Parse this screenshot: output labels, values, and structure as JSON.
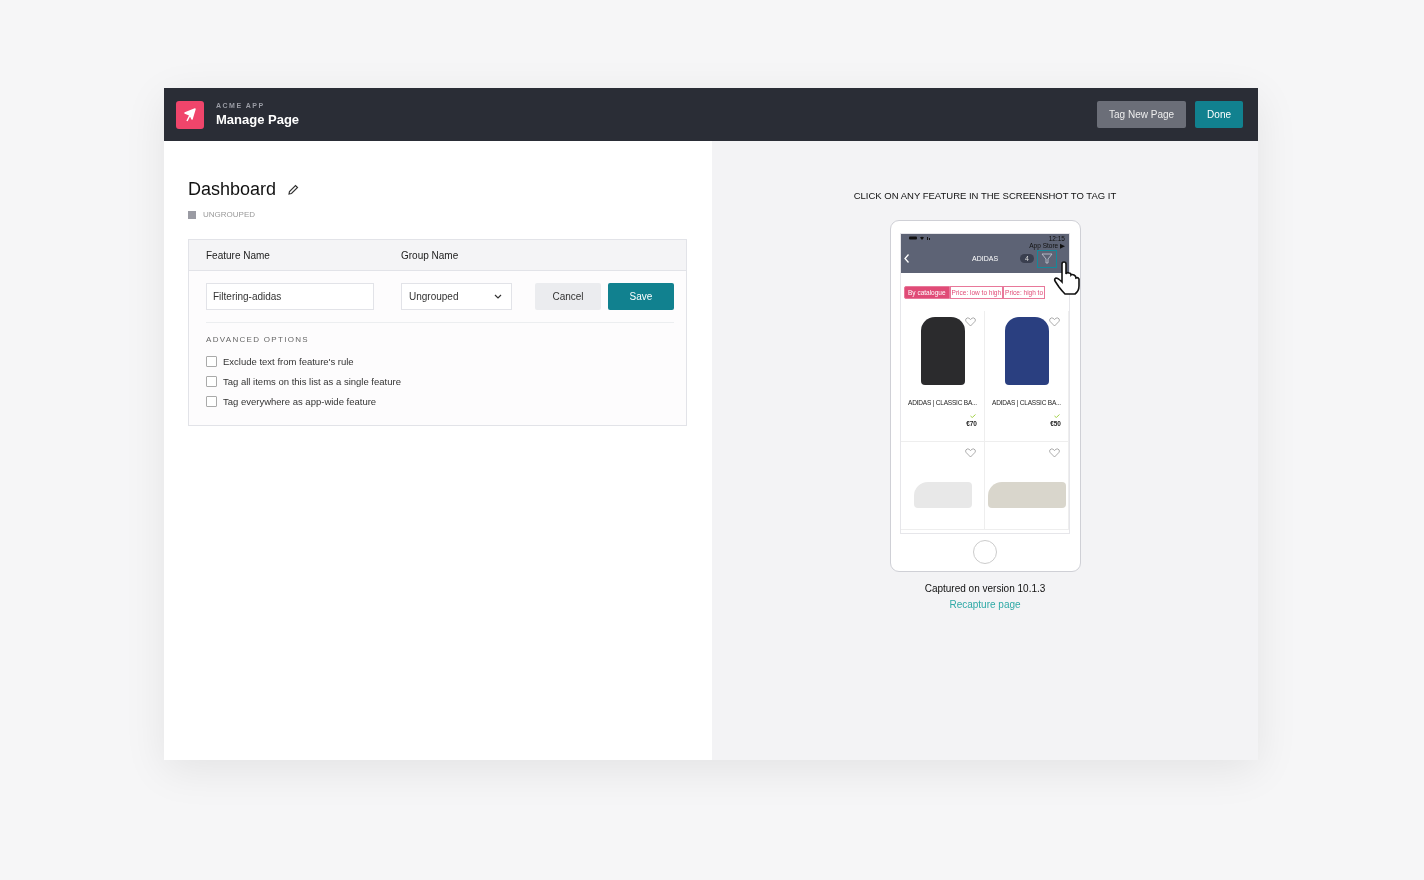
{
  "header": {
    "app_name": "ACME APP",
    "title": "Manage Page",
    "buttons": [
      {
        "label": "Tag New Page",
        "kind": "secondary"
      },
      {
        "label": "Done",
        "kind": "primary"
      }
    ]
  },
  "page": {
    "title": "Dashboard",
    "group": "UNGROUPED"
  },
  "form": {
    "columns": [
      "Feature Name",
      "Group Name"
    ],
    "feature_name": "Filtering-adidas",
    "group_select": "Ungrouped",
    "buttons": [
      {
        "label": "Cancel",
        "kind": "secondary"
      },
      {
        "label": "Save",
        "kind": "primary"
      }
    ],
    "advanced_title": "ADVANCED OPTIONS",
    "options": [
      {
        "label": "Exclude text from feature's rule",
        "checked": false
      },
      {
        "label": "Tag all items on this list as a single feature",
        "checked": false
      },
      {
        "label": "Tag everywhere as app-wide feature",
        "checked": false
      }
    ]
  },
  "preview": {
    "instruction": "CLICK ON ANY FEATURE IN THE SCREENSHOT TO TAG IT",
    "phone": {
      "time": "12:15",
      "back_link": "App Store ▶",
      "title": "ADIDAS",
      "badge": "4",
      "sort_tabs": [
        {
          "label": "By catalogue",
          "selected": true
        },
        {
          "label": "Price: low to high",
          "selected": false
        },
        {
          "label": "Price: high to",
          "selected": false
        }
      ],
      "products": [
        {
          "name": "ADIDAS | CLASSIC BA...",
          "price": "€70",
          "kind": "backpack"
        },
        {
          "name": "ADIDAS | CLASSIC BA...",
          "price": "€50",
          "kind": "backpack"
        },
        {
          "kind": "sneaker"
        },
        {
          "kind": "sneaker"
        }
      ]
    },
    "caption": "Captured on version 10.1.3",
    "link": "Recapture page"
  }
}
